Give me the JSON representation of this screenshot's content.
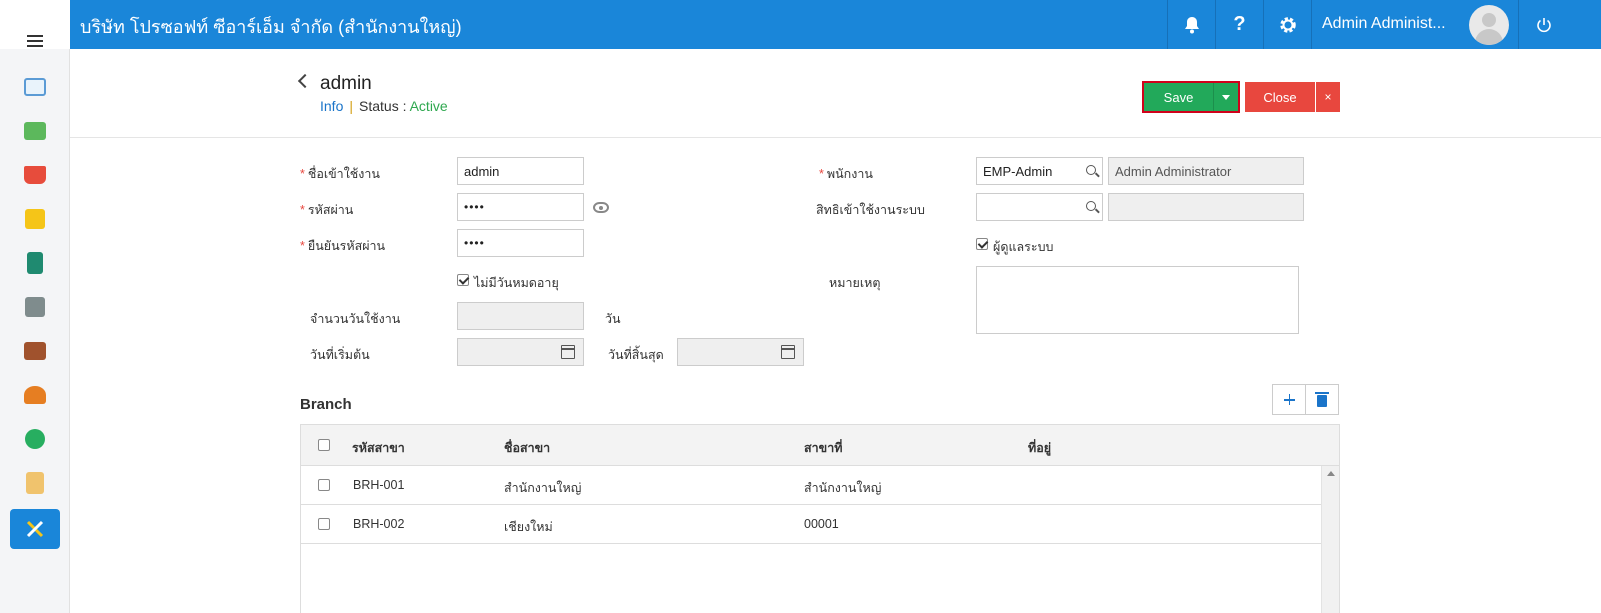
{
  "header": {
    "company": "บริษัท โปรซอฟท์ ซีอาร์เอ็ม จำกัด (สำนักงานใหญ่)",
    "user_name": "Admin Administ..."
  },
  "page": {
    "title": "admin",
    "info_link": "Info",
    "separator": "|",
    "status_label": "Status  :",
    "status_value": "Active"
  },
  "actions": {
    "save": "Save",
    "close": "Close",
    "close_x": "×"
  },
  "form": {
    "required_mark": "*",
    "username_label": "ชื่อเข้าใช้งาน",
    "username_value": "admin",
    "password_label": "รหัสผ่าน",
    "password_value": "••••",
    "confirm_label": "ยืนยันรหัสผ่าน",
    "confirm_value": "••••",
    "no_expire_label": "ไม่มีวันหมดอายุ",
    "no_expire_checked": true,
    "days_label": "จำนวนวันใช้งาน",
    "days_unit": "วัน",
    "start_label": "วันที่เริ่มต้น",
    "end_label": "วันที่สิ้นสุด",
    "employee_label": "พนักงาน",
    "employee_code": "EMP-Admin",
    "employee_name": "Admin Administrator",
    "permission_label": "สิทธิเข้าใช้งานระบบ",
    "permission_value": "",
    "sysadmin_label": "ผู้ดูแลระบบ",
    "sysadmin_checked": true,
    "note_label": "หมายเหตุ"
  },
  "branch": {
    "title": "Branch",
    "columns": [
      "รหัสสาขา",
      "ชื่อสาขา",
      "สาขาที่",
      "ที่อยู่"
    ],
    "rows": [
      {
        "code": "BRH-001",
        "name": "สำนักงานใหญ่",
        "branch_no": "สำนักงานใหญ่",
        "address": ""
      },
      {
        "code": "BRH-002",
        "name": "เชียงใหม่",
        "branch_no": "00001",
        "address": ""
      }
    ]
  },
  "colors": {
    "primary": "#1a86d9",
    "save": "#22a95a",
    "close": "#e8473e",
    "status_active": "#2fa84f"
  },
  "sidebar_icons": [
    "dashboard-icon",
    "money-icon",
    "cart-icon",
    "box-icon",
    "book-icon",
    "bank-icon",
    "wallet-icon",
    "people-icon",
    "check-icon",
    "document-icon",
    "tools-icon"
  ]
}
